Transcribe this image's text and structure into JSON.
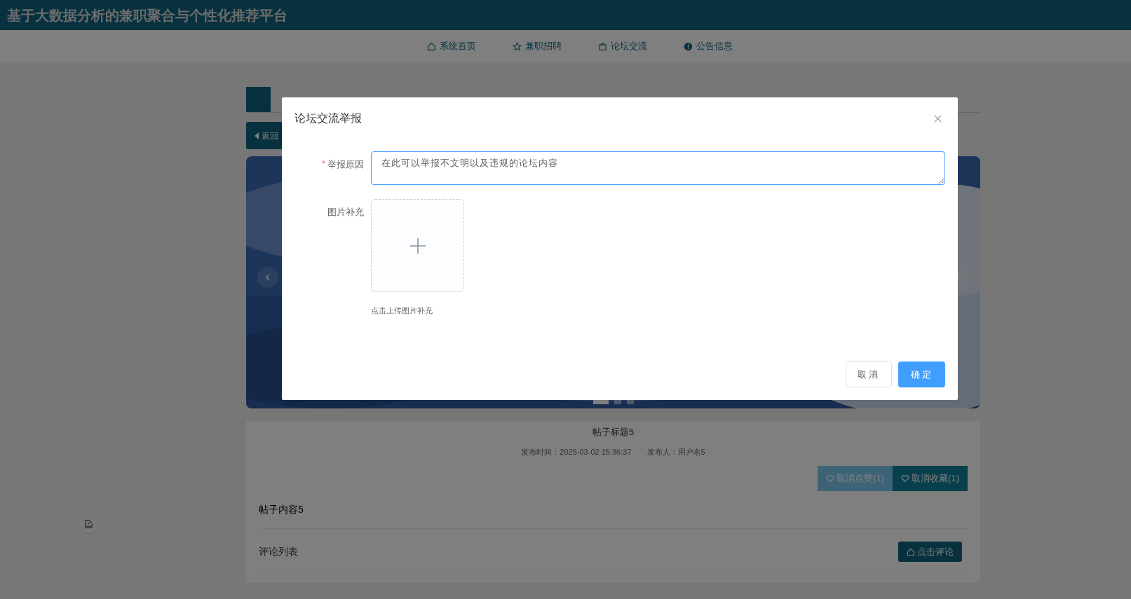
{
  "site_title": "基于大数据分析的兼职聚合与个性化推荐平台",
  "nav": [
    {
      "label": "系统首页"
    },
    {
      "label": "兼职招聘"
    },
    {
      "label": "论坛交流"
    },
    {
      "label": "公告信息"
    }
  ],
  "back_button": "返回",
  "carousel": {
    "kind": "picture",
    "indicators": [
      {
        "selected": true
      },
      {
        "selected": false
      },
      {
        "selected": false
      }
    ]
  },
  "post": {
    "title": "帖子标题5",
    "meta": [
      "发布时间：2025-03-02 15:36:37",
      "发布人：用户名5"
    ],
    "buttons": [
      {
        "label": "取消点赞(1)",
        "kind": "like"
      },
      {
        "label": "取消收藏(1)",
        "kind": "favorite"
      }
    ],
    "content": "帖子内容5",
    "comments_label": "评论列表",
    "comment_button": "点击评论"
  },
  "dialog": {
    "title": "论坛交流举报",
    "fields": [
      {
        "kind": "textarea",
        "label": "举报原因",
        "required_mark": "*",
        "value": "在此可以举报不文明以及违规的论坛内容"
      },
      {
        "kind": "upload",
        "label": "图片补充",
        "hint": "点击上传图片补充"
      }
    ],
    "buttons": [
      {
        "label": "取消",
        "primary": false
      },
      {
        "label": "确定",
        "primary": true
      }
    ]
  }
}
